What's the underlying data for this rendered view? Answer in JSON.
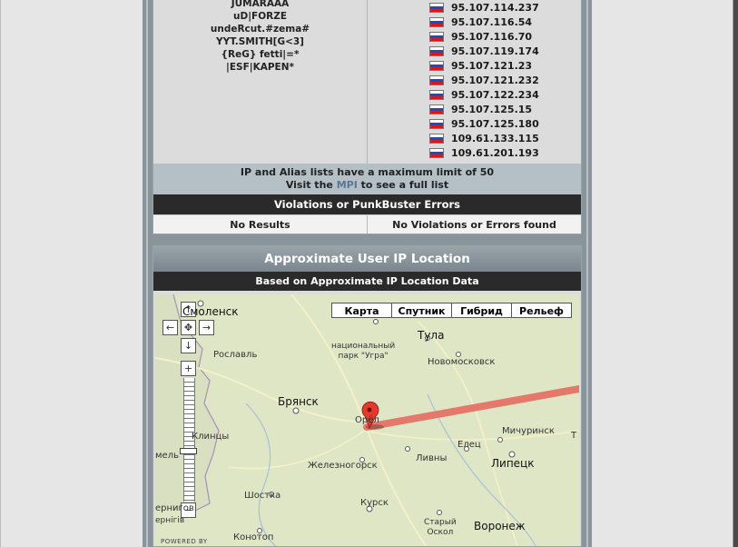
{
  "aliases": [
    "JUMARAAA",
    "uD|FORZE",
    "undeRcut.#zema#",
    "YYT.SMITH[G<3]",
    "{ReG} fetti|=*",
    "|ESF|KAPEN*"
  ],
  "ips": [
    "95.107.114.237",
    "95.107.116.54",
    "95.107.116.70",
    "95.107.119.174",
    "95.107.121.23",
    "95.107.121.232",
    "95.107.122.234",
    "95.107.125.15",
    "95.107.125.180",
    "109.61.133.115",
    "109.61.201.193"
  ],
  "limit_notice": {
    "line1": "IP and Alias lists have a maximum limit of 50",
    "line2_prefix": "Visit the",
    "link": "MPI",
    "line2_suffix": "to see a full list"
  },
  "violations": {
    "header": "Violations or PunkBuster Errors",
    "left": "No Results",
    "right": "No Violations or Errors found"
  },
  "location": {
    "title": "Approximate User IP Location",
    "subtitle": "Based on Approximate IP Location Data"
  },
  "map": {
    "type_buttons": [
      "Карта",
      "Спутник",
      "Гибрид",
      "Рельеф"
    ],
    "cities": {
      "smolensk": "Смоленск",
      "roslavl": "Рославль",
      "bryansk": "Брянск",
      "orel": "Орёл",
      "tula": "Тула",
      "novomoskovsk": "Новомосковск",
      "park": "национальный\nпарк \"Угра\"",
      "klintsy": "Клинцы",
      "zheleznogorsk": "Железногорск",
      "livny": "Ливны",
      "elets": "Елец",
      "lipetsk": "Липецк",
      "michurinsk": "Мичуринск",
      "kursk": "Курск",
      "shostka": "Шостка",
      "stary_oskol": "Старый\nОскол",
      "voronezh": "Воронеж",
      "konotop": "Конотоп",
      "chernigiv": "ернігів",
      "gomel_part": "мель",
      "cherni_part": "ернигов",
      "t_part": "Т"
    },
    "powered_by": "POWERED BY",
    "route_color": "#e4786a",
    "marker_color": "#e23b2e"
  }
}
